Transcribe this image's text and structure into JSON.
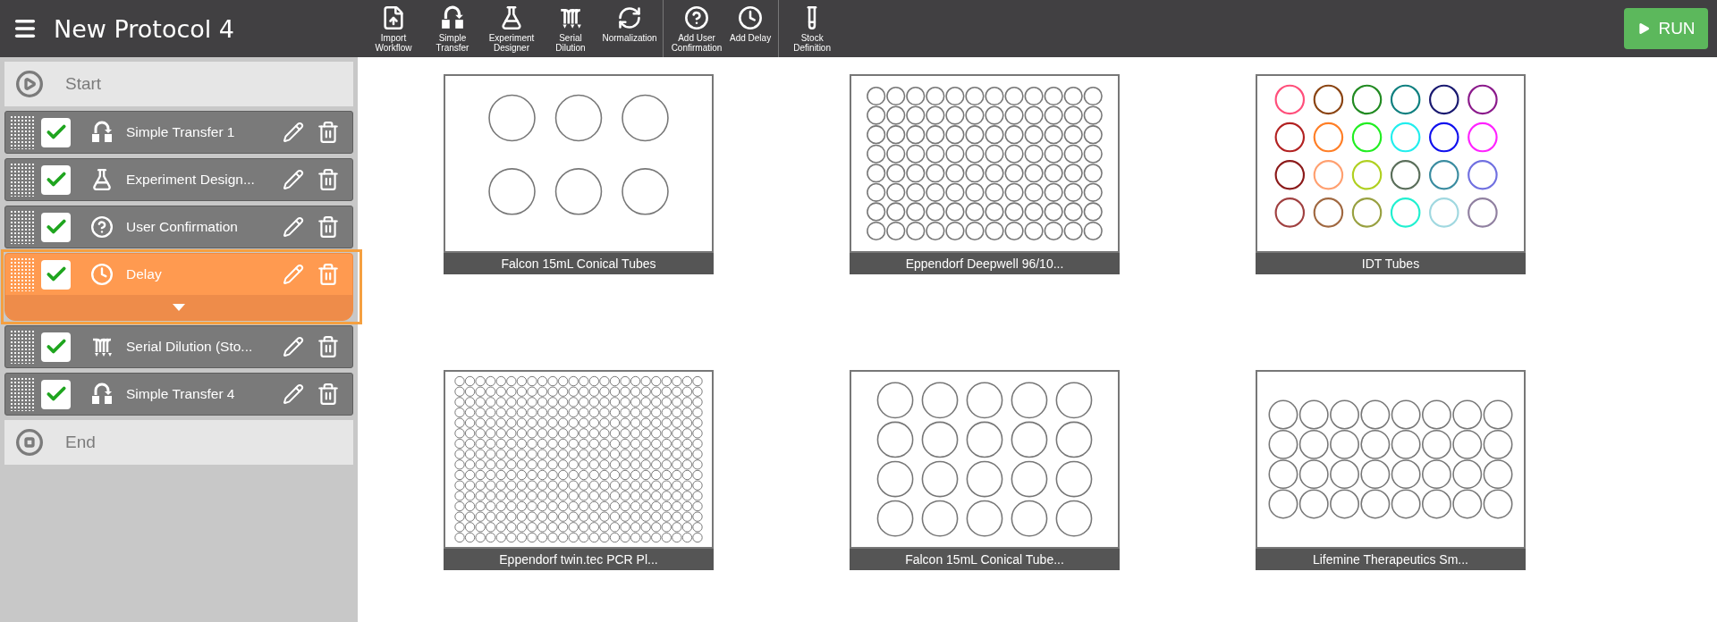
{
  "header": {
    "title": "New Protocol 4",
    "run_button": "RUN"
  },
  "toolbar": [
    [
      {
        "kind": "import",
        "label": "Import Workflow"
      },
      {
        "kind": "transfer",
        "label": "Simple Transfer"
      },
      {
        "kind": "flask",
        "label": "Experiment Designer"
      },
      {
        "kind": "dilution",
        "label": "Serial Dilution"
      },
      {
        "kind": "normalize",
        "label": "Normalization"
      }
    ],
    [
      {
        "kind": "question",
        "label": "Add User Confirmation"
      },
      {
        "kind": "clock",
        "label": "Add Delay"
      }
    ],
    [
      {
        "kind": "stock",
        "label": "Stock Definition"
      }
    ]
  ],
  "sidebar": {
    "start": "Start",
    "end": "End",
    "steps": [
      {
        "kind": "transfer",
        "label": "Simple Transfer 1",
        "checked": true,
        "selected": false,
        "expanded": false
      },
      {
        "kind": "flask",
        "label": "Experiment Design...",
        "checked": true,
        "selected": false,
        "expanded": false
      },
      {
        "kind": "question",
        "label": "User Confirmation",
        "checked": true,
        "selected": false,
        "expanded": false
      },
      {
        "kind": "clock",
        "label": "Delay",
        "checked": true,
        "selected": true,
        "expanded": true
      },
      {
        "kind": "dilution",
        "label": "Serial Dilution (Sto...",
        "checked": true,
        "selected": false,
        "expanded": false
      },
      {
        "kind": "transfer",
        "label": "Simple Transfer 4",
        "checked": true,
        "selected": false,
        "expanded": false
      }
    ]
  },
  "labware": [
    {
      "kind": "rack6",
      "name": "Falcon 15mL Conical Tubes"
    },
    {
      "kind": "plate96",
      "name": "Eppendorf Deepwell 96/10..."
    },
    {
      "kind": "colored24",
      "name": "IDT Tubes",
      "tubes": [
        {
          "color": "#ff4f7b"
        },
        {
          "color": "#8b4513"
        },
        {
          "color": "#228b22"
        },
        {
          "color": "#108080"
        },
        {
          "color": "#191970"
        },
        {
          "color": "#8b1a8b"
        },
        {
          "color": "#b22222"
        },
        {
          "color": "#ff7f27"
        },
        {
          "color": "#22ee22"
        },
        {
          "color": "#22eeee"
        },
        {
          "color": "#1010ee"
        },
        {
          "color": "#ff22ff"
        },
        {
          "color": "#8b1a1a"
        },
        {
          "color": "#ffa070"
        },
        {
          "color": "#b0d020"
        },
        {
          "color": "#5a6e5a"
        },
        {
          "color": "#3a8ca0"
        },
        {
          "color": "#7070e0"
        },
        {
          "color": "#a04040"
        },
        {
          "color": "#a06840"
        },
        {
          "color": "#98a040"
        },
        {
          "color": "#20f0d0"
        },
        {
          "color": "#a0d8e0"
        },
        {
          "color": "#9080a0"
        }
      ]
    },
    {
      "kind": "plate384",
      "name": "Eppendorf twin.tec PCR Pl..."
    },
    {
      "kind": "rack20",
      "name": "Falcon 15mL Conical Tube..."
    },
    {
      "kind": "rack32",
      "name": "Lifemine Therapeutics Sm..."
    }
  ]
}
